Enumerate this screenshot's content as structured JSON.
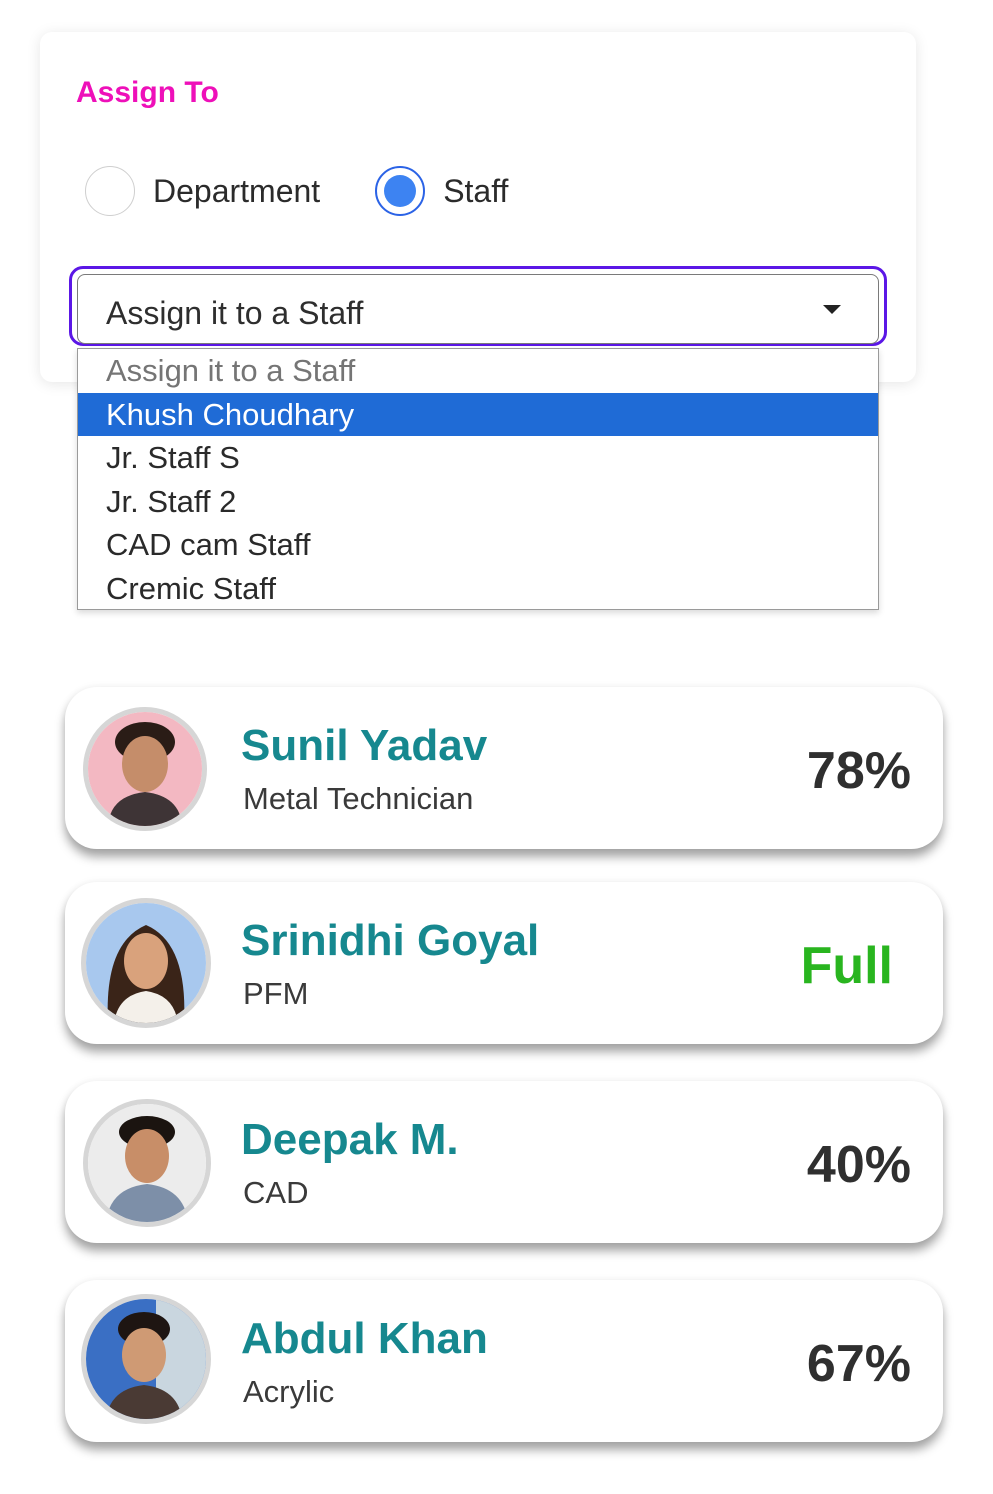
{
  "assign": {
    "title": "Assign To",
    "radio_options": [
      {
        "label": "Department",
        "checked": false
      },
      {
        "label": "Staff",
        "checked": true
      }
    ],
    "select": {
      "value": "Assign it to a Staff",
      "options": [
        {
          "label": "Assign it to a Staff",
          "placeholder": true
        },
        {
          "label": "Khush Choudhary",
          "highlighted": true
        },
        {
          "label": "Jr. Staff S"
        },
        {
          "label": "Jr. Staff 2"
        },
        {
          "label": "CAD cam Staff"
        },
        {
          "label": "Cremic Staff"
        }
      ]
    },
    "colors": {
      "title": "#ee10b9",
      "radio_checked": "#3d83f2",
      "focus_ring": "#5b17e6",
      "highlight": "#1f6bd6"
    }
  },
  "staff": [
    {
      "name": "Sunil Yadav",
      "role": "Metal Technician",
      "load": "78%",
      "avatar_bg": "#f3b8c2"
    },
    {
      "name": "Srinidhi Goyal",
      "role": "PFM",
      "load": "Full",
      "avatar_bg": "#a8c8ee"
    },
    {
      "name": "Deepak M.",
      "role": "CAD",
      "load": "40%",
      "avatar_bg": "#ececec"
    },
    {
      "name": "Abdul Khan",
      "role": "Acrylic",
      "load": "67%",
      "avatar_bg": "#3a6fc4"
    }
  ],
  "staff_colors": {
    "name": "#16888f",
    "load": "#2f2f2f",
    "full": "#29b51f"
  }
}
